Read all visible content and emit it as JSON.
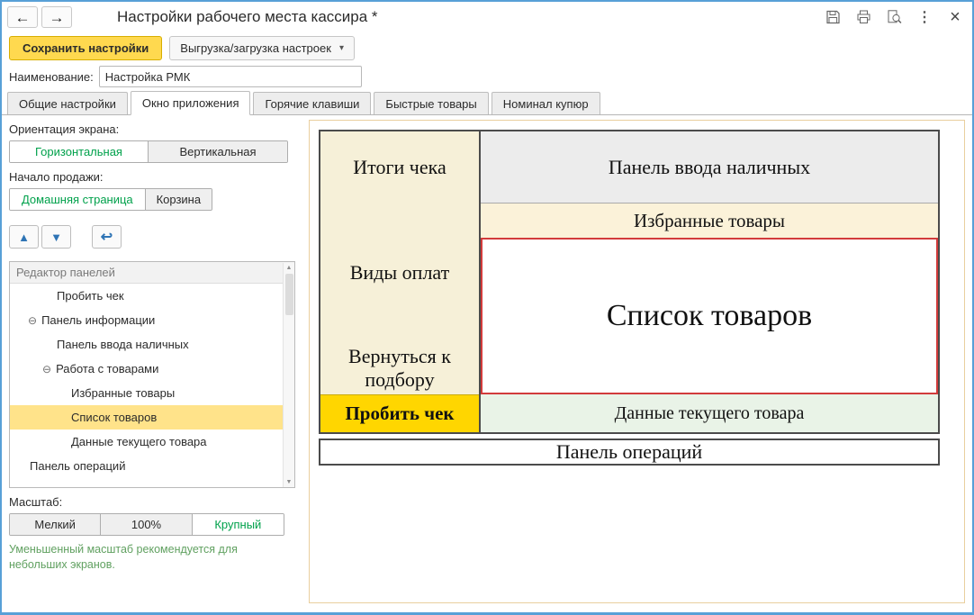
{
  "icons": {
    "back": "←",
    "forward": "→",
    "caret_down": "▾",
    "move_up": "▲",
    "move_down": "▼",
    "reset": "↩",
    "collapse": "⊖",
    "scroll_up": "▲",
    "scroll_down": "▼",
    "more": "⋮",
    "close": "×"
  },
  "window": {
    "title": "Настройки рабочего места кассира *"
  },
  "toolbar": {
    "save_label": "Сохранить настройки",
    "export_label": "Выгрузка/загрузка настроек"
  },
  "name_field": {
    "label": "Наименование:",
    "value": "Настройка РМК"
  },
  "tabs": [
    {
      "label": "Общие настройки",
      "active": false
    },
    {
      "label": "Окно приложения",
      "active": true
    },
    {
      "label": "Горячие клавиши",
      "active": false
    },
    {
      "label": "Быстрые товары",
      "active": false
    },
    {
      "label": "Номинал купюр",
      "active": false
    }
  ],
  "left_panel": {
    "orientation": {
      "label": "Ориентация экрана:",
      "options": [
        {
          "label": "Горизонтальная",
          "active": true
        },
        {
          "label": "Вертикальная",
          "active": false
        }
      ]
    },
    "sale_start": {
      "label": "Начало продажи:",
      "options": [
        {
          "label": "Домашняя страница",
          "active": true
        },
        {
          "label": "Корзина",
          "active": false
        }
      ]
    },
    "panel_editor": {
      "header": "Редактор панелей",
      "items": [
        {
          "label": "Пробить чек",
          "level": 2,
          "expandable": false,
          "selected": false
        },
        {
          "label": "Панель информации",
          "level": 1,
          "expandable": true,
          "selected": false
        },
        {
          "label": "Панель ввода наличных",
          "level": 2,
          "expandable": false,
          "selected": false
        },
        {
          "label": "Работа с товарами",
          "level": 2,
          "expandable": true,
          "selected": false
        },
        {
          "label": "Избранные товары",
          "level": 3,
          "expandable": false,
          "selected": false
        },
        {
          "label": "Список товаров",
          "level": 3,
          "expandable": false,
          "selected": true
        },
        {
          "label": "Данные текущего товара",
          "level": 3,
          "expandable": false,
          "selected": false
        },
        {
          "label": "Панель операций",
          "level": 1,
          "expandable": false,
          "selected": false
        }
      ]
    },
    "scale": {
      "label": "Масштаб:",
      "options": [
        {
          "label": "Мелкий",
          "active": false
        },
        {
          "label": "100%",
          "active": false
        },
        {
          "label": "Крупный",
          "active": true
        }
      ],
      "hint": "Уменьшенный масштаб рекомендуется для небольших экранов."
    }
  },
  "preview": {
    "left_column": [
      {
        "label": "Итоги чека",
        "highlight": false
      },
      {
        "label": "Виды оплат",
        "highlight": false
      },
      {
        "label": "Вернуться к подбору",
        "highlight": false
      },
      {
        "label": "Пробить чек",
        "highlight": true
      }
    ],
    "cash_input_panel": "Панель ввода наличных",
    "favorites_panel": "Избранные товары",
    "product_list_panel": "Список товаров",
    "current_product_panel": "Данные текущего товара",
    "operations_panel": "Панель операций"
  }
}
